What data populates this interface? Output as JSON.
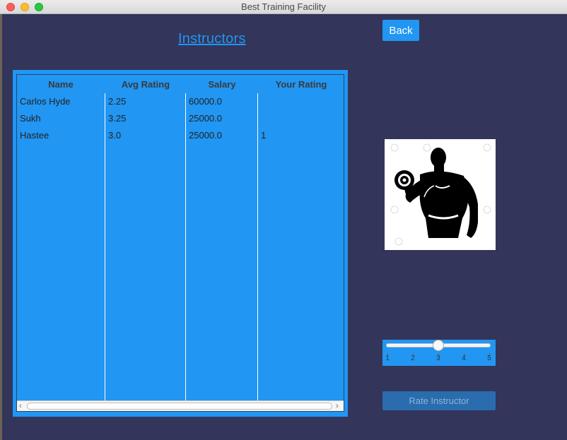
{
  "window": {
    "title": "Best Training Facility"
  },
  "page": {
    "title": "Instructors",
    "back_label": "Back"
  },
  "table": {
    "headers": [
      "Name",
      "Avg Rating",
      "Salary",
      "Your Rating"
    ],
    "rows": [
      [
        "Carlos Hyde",
        "2.25",
        "60000.0",
        ""
      ],
      [
        "Sukh",
        "3.25",
        "25000.0",
        ""
      ],
      [
        "Hastee",
        "3.0",
        "25000.0",
        "1"
      ]
    ]
  },
  "image": {
    "description_icon": "dumbbell-bodybuilder-icon"
  },
  "slider": {
    "min": 1,
    "max": 5,
    "value": 3,
    "ticks": [
      "1",
      "2",
      "3",
      "4",
      "5"
    ]
  },
  "rate_button": {
    "label": "Rate Instructor"
  },
  "colors": {
    "background": "#33355a",
    "accent": "#2196f3",
    "rate_button": "#2a6cae"
  }
}
